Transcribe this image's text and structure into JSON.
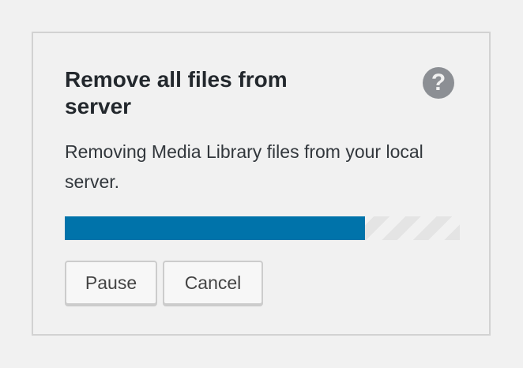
{
  "dialog": {
    "title": "Remove all files from server",
    "help_icon": "question-circle-icon",
    "help_glyph": "?",
    "description": "Removing Media Library files from your local server.",
    "progress": {
      "percent": 76,
      "fill_color": "#0073aa"
    },
    "buttons": {
      "pause_label": "Pause",
      "cancel_label": "Cancel"
    }
  }
}
